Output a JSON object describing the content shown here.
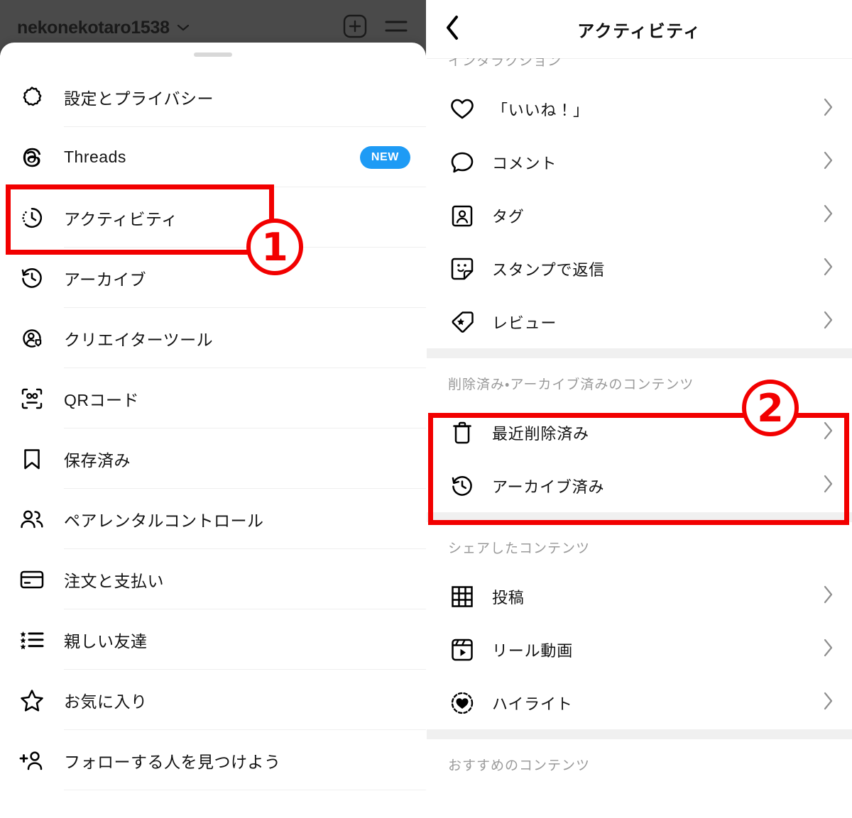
{
  "left_panel": {
    "topbar": {
      "username": "nekonekotaro1538",
      "chevron": "chevron-down-icon",
      "new_post_icon": "plus-square-icon",
      "menu_icon": "hamburger-menu-icon"
    },
    "menu_items": [
      {
        "label": "設定とプライバシー",
        "icon": "gear-icon",
        "badge": ""
      },
      {
        "label": "Threads",
        "icon": "threads-icon",
        "badge": "NEW"
      },
      {
        "label": "アクティビティ",
        "icon": "activity-clock-icon",
        "badge": ""
      },
      {
        "label": "アーカイブ",
        "icon": "archive-clock-icon",
        "badge": ""
      },
      {
        "label": "クリエイターツール",
        "icon": "creator-tools-icon",
        "badge": ""
      },
      {
        "label": "QRコード",
        "icon": "qr-code-icon",
        "badge": ""
      },
      {
        "label": "保存済み",
        "icon": "bookmark-icon",
        "badge": ""
      },
      {
        "label": "ペアレンタルコントロール",
        "icon": "people-icon",
        "badge": ""
      },
      {
        "label": "注文と支払い",
        "icon": "credit-card-icon",
        "badge": ""
      },
      {
        "label": "親しい友達",
        "icon": "close-friends-list-icon",
        "badge": ""
      },
      {
        "label": "お気に入り",
        "icon": "star-icon",
        "badge": ""
      },
      {
        "label": "フォローする人を見つけよう",
        "icon": "add-person-icon",
        "badge": ""
      }
    ]
  },
  "right_panel": {
    "header": {
      "title": "アクティビティ",
      "back_icon": "chevron-left-icon"
    },
    "sections": [
      {
        "heading": "インタラクション",
        "clipped": true,
        "items": [
          {
            "label": "「いいね！」",
            "icon": "heart-icon",
            "chevron": "chevron-right-icon"
          },
          {
            "label": "コメント",
            "icon": "comment-bubble-icon",
            "chevron": "chevron-right-icon"
          },
          {
            "label": "タグ",
            "icon": "tag-person-icon",
            "chevron": "chevron-right-icon"
          },
          {
            "label": "スタンプで返信",
            "icon": "sticker-icon",
            "chevron": "chevron-right-icon"
          },
          {
            "label": "レビュー",
            "icon": "review-tag-icon",
            "chevron": "chevron-right-icon"
          }
        ]
      },
      {
        "heading": "削除済み・アーカイブ済みのコンテンツ",
        "clipped": false,
        "items": [
          {
            "label": "最近削除済み",
            "icon": "trash-icon",
            "chevron": "chevron-right-icon"
          },
          {
            "label": "アーカイブ済み",
            "icon": "archive-clock-icon",
            "chevron": "chevron-right-icon"
          }
        ]
      },
      {
        "heading": "シェアしたコンテンツ",
        "clipped": false,
        "items": [
          {
            "label": "投稿",
            "icon": "grid-icon",
            "chevron": "chevron-right-icon"
          },
          {
            "label": "リール動画",
            "icon": "reels-icon",
            "chevron": "chevron-right-icon"
          },
          {
            "label": "ハイライト",
            "icon": "highlight-heart-icon",
            "chevron": "chevron-right-icon"
          }
        ]
      },
      {
        "heading": "おすすめのコンテンツ",
        "clipped": false,
        "items": []
      }
    ]
  },
  "annotations": {
    "marker_one": "1",
    "marker_two": "2",
    "box_color": "#f20000"
  }
}
